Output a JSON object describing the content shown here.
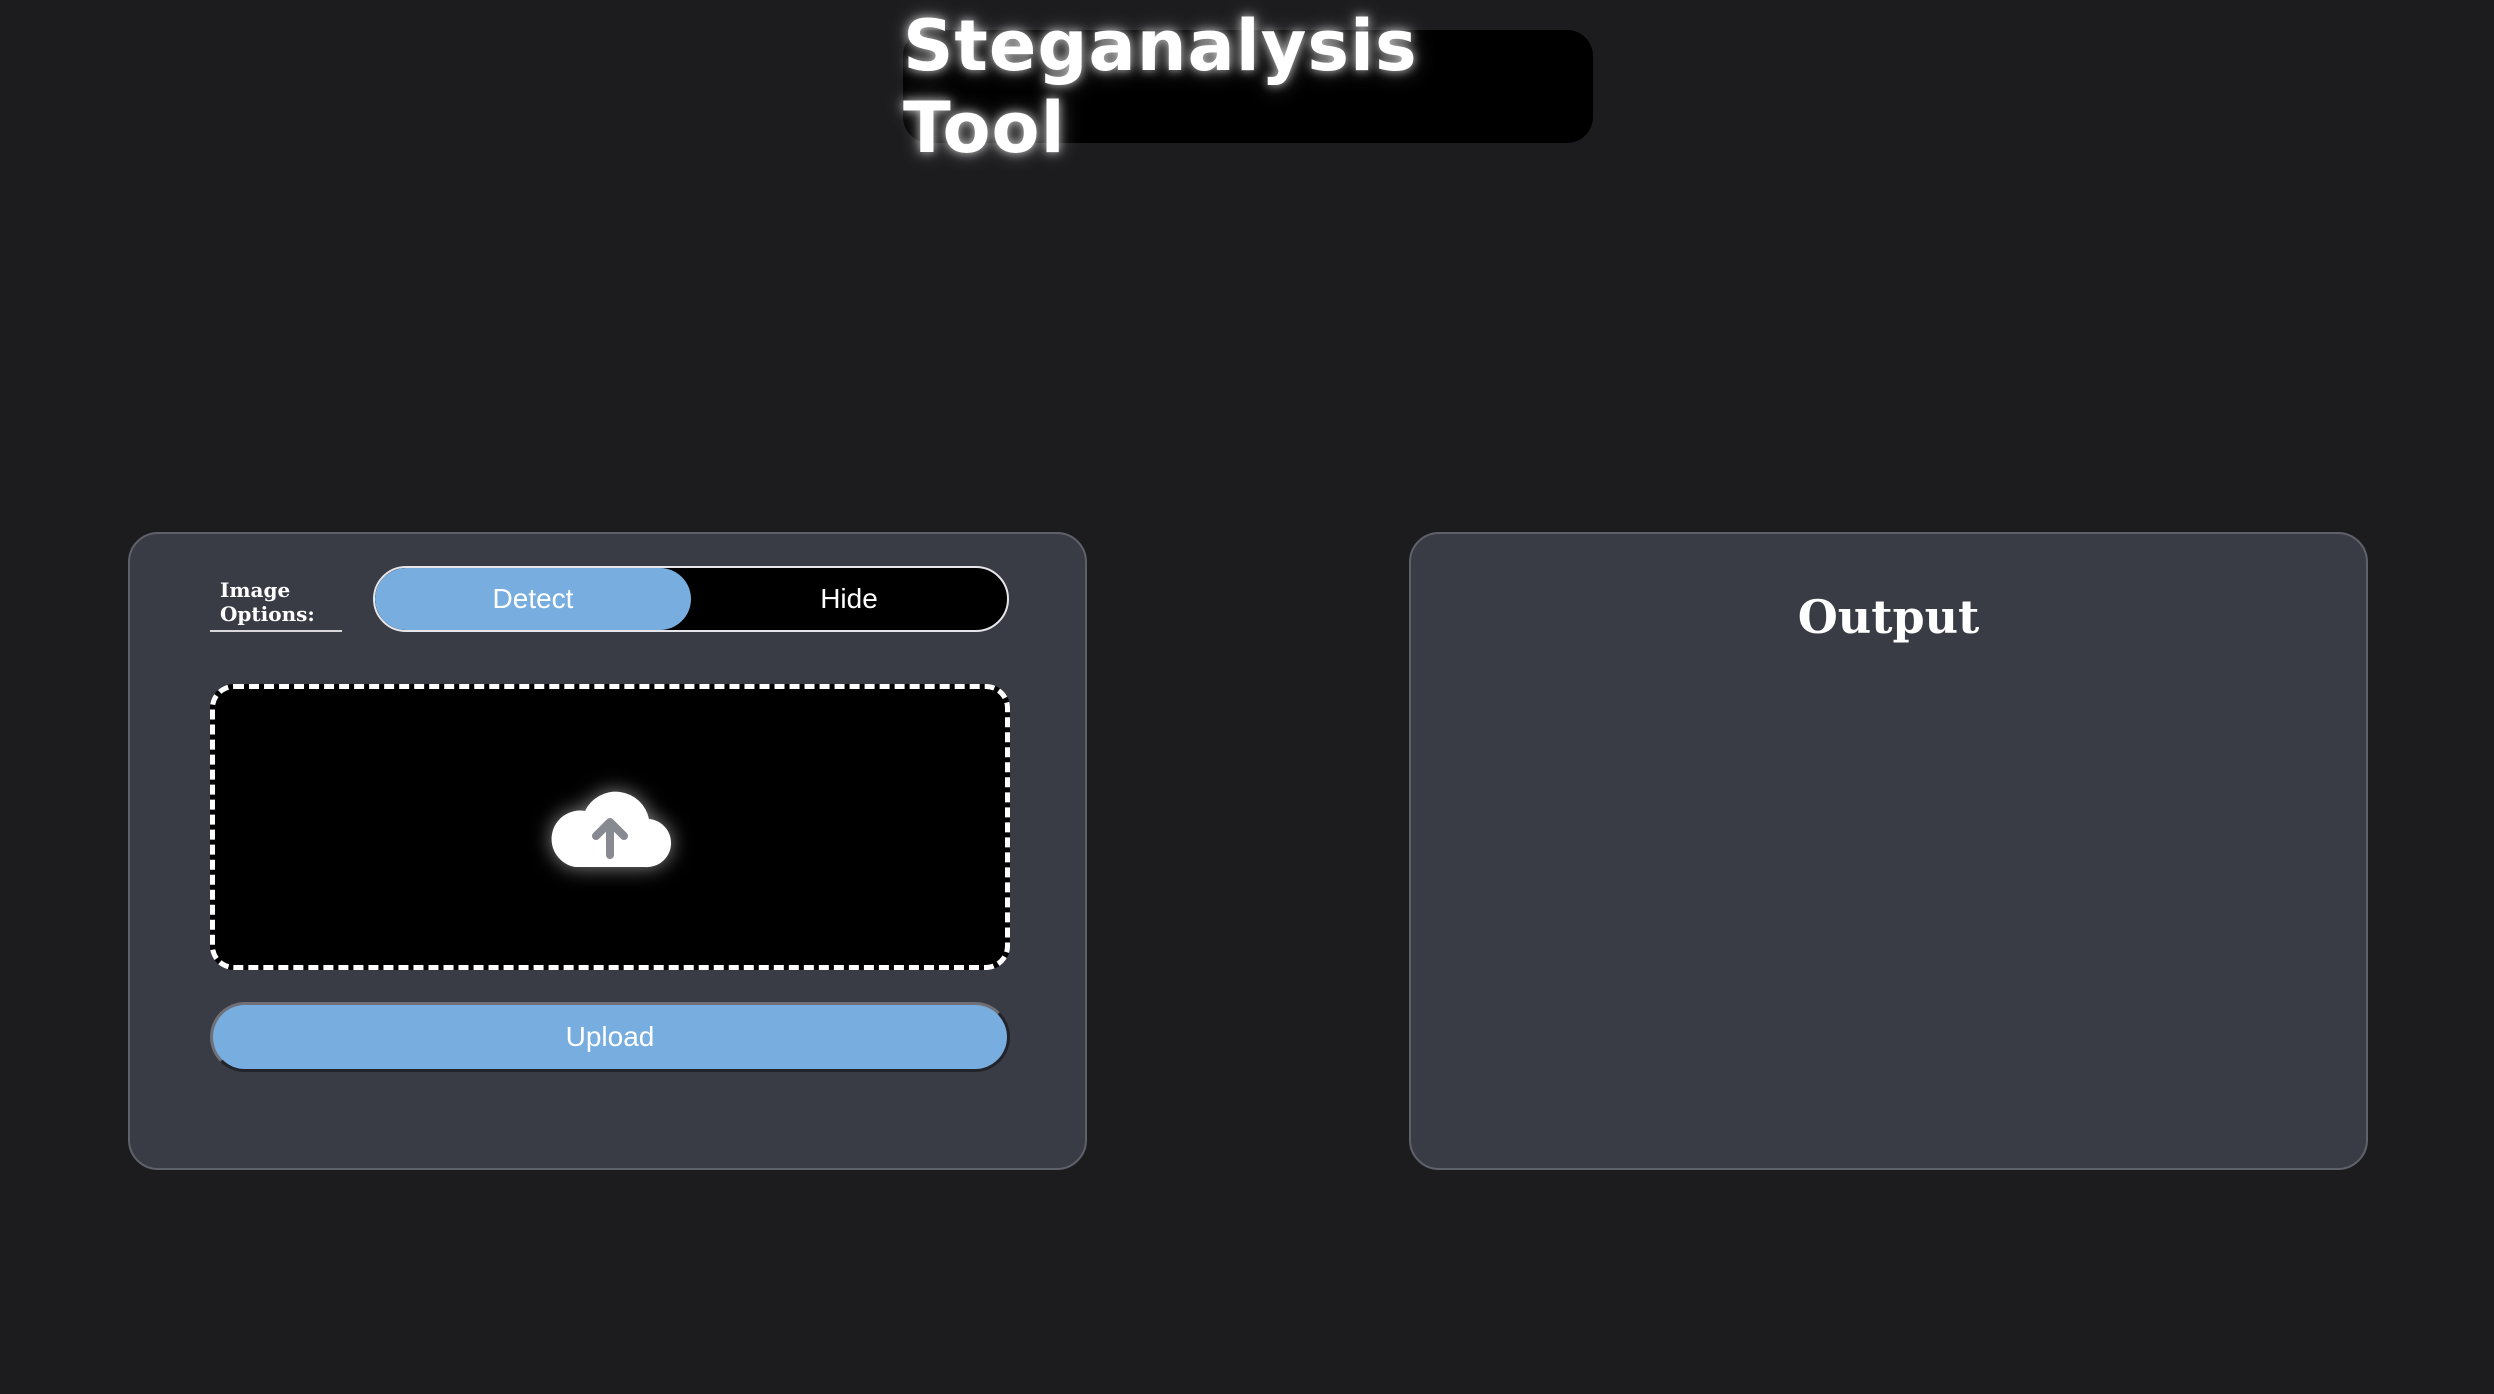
{
  "header": {
    "title": "Steganalysis Tool"
  },
  "input_panel": {
    "options_label": "Image Options:",
    "toggle": {
      "options": [
        {
          "label": "Detect",
          "selected": true
        },
        {
          "label": "Hide",
          "selected": false
        }
      ]
    },
    "dropzone": {
      "icon": "cloud-upload-icon"
    },
    "upload_label": "Upload"
  },
  "output_panel": {
    "title": "Output"
  },
  "colors": {
    "background": "#1c1b1d",
    "panel": "#393b45",
    "accent": "#77aedf",
    "title_box": "#000000"
  }
}
